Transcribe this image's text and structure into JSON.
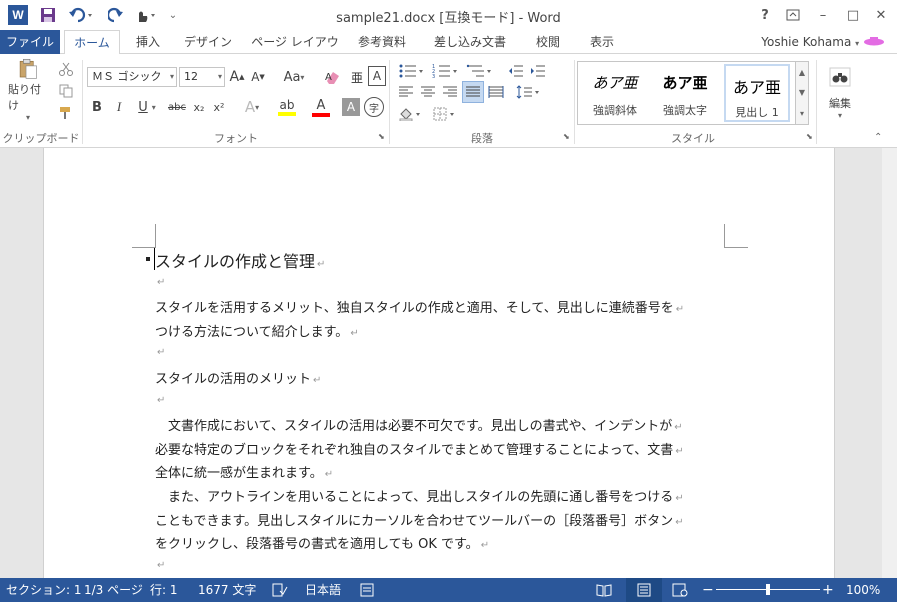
{
  "window": {
    "title": "sample21.docx [互換モード] - Word",
    "app_icon_letter": "W"
  },
  "qat": {
    "save_icon": "save-icon",
    "undo_icon": "undo-icon",
    "redo_icon": "redo-icon",
    "touch_icon": "touch-mode-icon",
    "customize_icon": "customize-qat-icon"
  },
  "window_controls": {
    "help": "?",
    "ribbon_options": "ribbon-display-icon",
    "minimize": "–",
    "maximize": "□",
    "close": "✕"
  },
  "tabs": [
    {
      "label": "ファイル"
    },
    {
      "label": "ホーム"
    },
    {
      "label": "挿入"
    },
    {
      "label": "デザイン"
    },
    {
      "label": "ページ レイアウト"
    },
    {
      "label": "参考資料"
    },
    {
      "label": "差し込み文書"
    },
    {
      "label": "校閲"
    },
    {
      "label": "表示"
    }
  ],
  "user": {
    "name": "Yoshie Kohama"
  },
  "ribbon": {
    "clipboard": {
      "paste_label": "貼り付け",
      "group_label": "クリップボード"
    },
    "font": {
      "font_name": "ＭＳ ゴシック",
      "font_size": "12",
      "group_label": "フォント",
      "bold": "B",
      "italic": "I",
      "underline": "U",
      "strike": "abc",
      "subscript": "x₂",
      "superscript": "x²",
      "grow": "A",
      "shrink": "A",
      "case": "Aa",
      "text_effect": "A",
      "font_color": "A",
      "shading": "A",
      "border": "A",
      "phonetic": "字",
      "highlight_color": "#ffff00",
      "font_color_value": "#ff0000"
    },
    "paragraph": {
      "group_label": "段落"
    },
    "styles": {
      "group_label": "スタイル",
      "items": [
        {
          "preview": "あア亜",
          "name": "強調斜体"
        },
        {
          "preview": "あア亜",
          "name": "強調太字"
        },
        {
          "preview": "あア亜",
          "name": "見出し 1"
        }
      ]
    },
    "editing": {
      "label": "編集"
    }
  },
  "document": {
    "lines": [
      {
        "text": "スタイルの作成と管理",
        "style": "heading"
      },
      {
        "text": ""
      },
      {
        "text": "スタイルを活用するメリット、独自スタイルの作成と適用、そして、見出しに連続番号を"
      },
      {
        "text": "つける方法について紹介します。"
      },
      {
        "text": ""
      },
      {
        "text": "スタイルの活用のメリット"
      },
      {
        "text": ""
      },
      {
        "text": "　文書作成において、スタイルの活用は必要不可欠です。見出しの書式や、インデントが"
      },
      {
        "text": "必要な特定のブロックをそれぞれ独自のスタイルでまとめて管理することによって、文書"
      },
      {
        "text": "全体に統一感が生まれます。"
      },
      {
        "text": "　また、アウトラインを用いることによって、見出しスタイルの先頭に通し番号をつける"
      },
      {
        "text": "こともできます。見出しスタイルにカーソルを合わせてツールバーの［段落番号］ボタン"
      },
      {
        "text": "をクリックし、段落番号の書式を適用しても OK です。"
      },
      {
        "text": ""
      }
    ],
    "paragraph_mark": "↵"
  },
  "statusbar": {
    "section": "セクション: 1",
    "page": "1/3 ページ",
    "line": "行: 1",
    "words": "1677 文字",
    "language": "日本語",
    "zoom": "100%",
    "zoom_minus": "−",
    "zoom_plus": "+",
    "zoom_level": 0.5
  }
}
